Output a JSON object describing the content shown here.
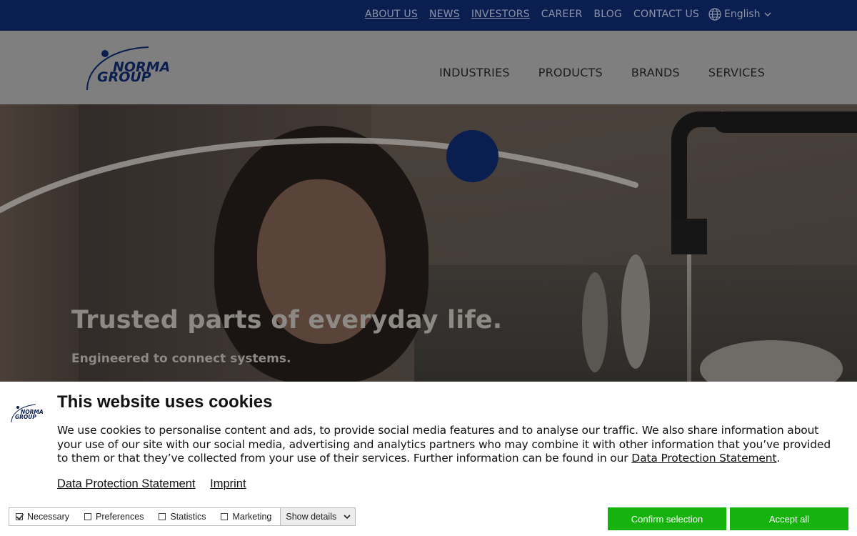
{
  "top_nav": {
    "items": [
      "ABOUT US",
      "NEWS",
      "INVESTORS",
      "CAREER",
      "BLOG",
      "CONTACT US"
    ],
    "language": "English"
  },
  "logo": {
    "line1": "NORMA",
    "line2": "GROUP"
  },
  "main_nav": {
    "items": [
      "INDUSTRIES",
      "PRODUCTS",
      "BRANDS",
      "SERVICES"
    ]
  },
  "hero": {
    "title": "Trusted parts of everyday life.",
    "subtitle": "Engineered to connect systems."
  },
  "cookie": {
    "title": "This website uses cookies",
    "text_before_link": "We use cookies to personalise content and ads, to provide social media features and to analyse our traffic. We also share information about your use of our site with our social media, advertising and analytics partners who may combine it with other information that you’ve provided to them or that they’ve collected from your use of their services. Further information can be found in our ",
    "text_link": "Data Protection Statement",
    "text_after_link": ".",
    "links": [
      "Data Protection Statement",
      "Imprint"
    ],
    "options": [
      {
        "label": "Necessary",
        "checked": true
      },
      {
        "label": "Preferences",
        "checked": false
      },
      {
        "label": "Statistics",
        "checked": false
      },
      {
        "label": "Marketing",
        "checked": false
      }
    ],
    "show_details": "Show details",
    "confirm_label": "Confirm selection",
    "accept_label": "Accept all"
  },
  "colors": {
    "brand_navy": "#0a1e4f",
    "button_green": "#16b30f"
  }
}
